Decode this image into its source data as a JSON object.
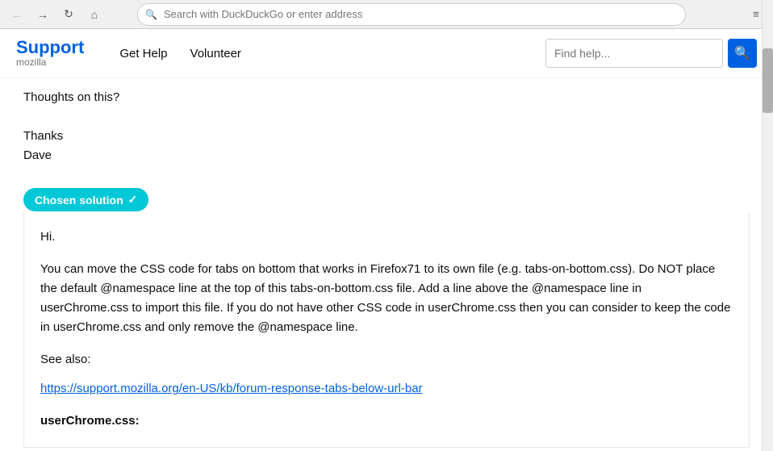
{
  "browser": {
    "back_button_label": "←",
    "forward_button_label": "→",
    "reload_button_label": "↻",
    "home_button_label": "⌂",
    "address_placeholder": "Search with DuckDuckGo or enter address",
    "menu_button_label": "≡",
    "search_icon": "🔍"
  },
  "header": {
    "logo_support": "Support",
    "logo_mozilla": "mozilla",
    "nav_items": [
      {
        "label": "Get Help"
      },
      {
        "label": "Volunteer"
      }
    ],
    "search_placeholder": "Find help...",
    "search_button_label": "🔍"
  },
  "post": {
    "text_line1": "Thoughts on this?",
    "text_line2": "",
    "thanks": "Thanks",
    "author": "Dave"
  },
  "solution": {
    "badge_label": "Chosen solution",
    "check_icon": "✓",
    "greeting": "Hi.",
    "body": "You can move the CSS code for tabs on bottom that works in Firefox71 to its own file (e.g. tabs-on-bottom.css). Do NOT place the default @namespace line at the top of this tabs-on-bottom.css file. Add a line above the @namespace line in userChrome.css to import this file. If you do not have other CSS code in userChrome.css then you can consider to keep the code in userChrome.css and only remove the @namespace line.",
    "see_also": "See also:",
    "link_text": "https://support.mozilla.org/en-US/kb/forum-response-tabs-below-url-bar",
    "link_href": "https://support.mozilla.org/en-US/kb/forum-response-tabs-below-url-bar",
    "code_label": "userChrome.css",
    "code_colon": ":"
  }
}
